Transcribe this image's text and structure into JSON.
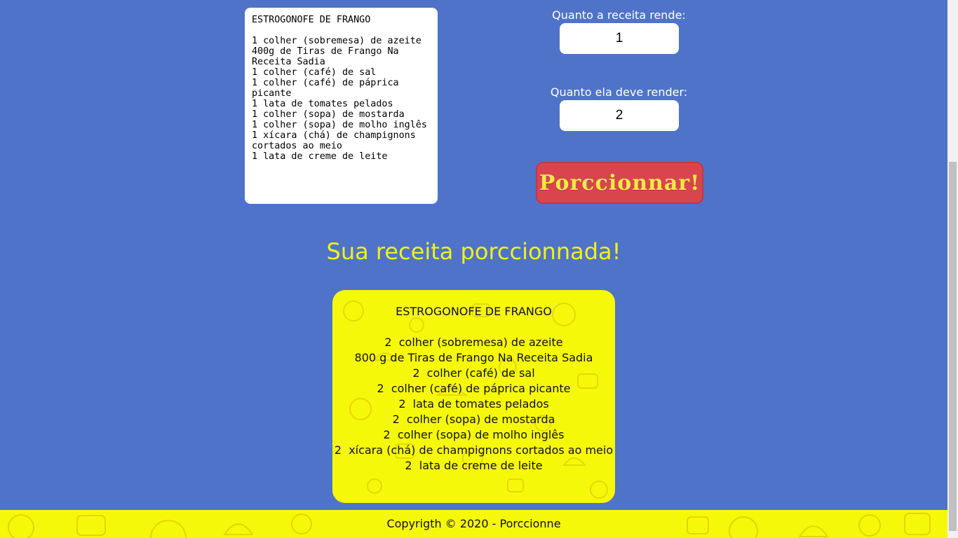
{
  "input": {
    "recipe_text": "ESTROGONOFE DE FRANGO\n\n1 colher (sobremesa) de azeite\n400g de Tiras de Frango Na Receita Sadia\n1 colher (café) de sal\n1 colher (café) de páprica picante\n1 lata de tomates pelados\n1 colher (sopa) de mostarda\n1 colher (sopa) de molho inglês\n1 xícara (chá) de champignons cortados ao meio\n1 lata de creme de leite"
  },
  "controls": {
    "yield_label": "Quanto a receita rende:",
    "yield_value": "1",
    "target_label": "Quanto ela deve render:",
    "target_value": "2",
    "button_label": "Porccionnar!"
  },
  "result": {
    "title": "Sua receita porccionnada!",
    "lines": [
      "ESTROGONOFE DE FRANGO",
      "",
      "2  colher (sobremesa) de azeite",
      "800 g de Tiras de Frango Na Receita Sadia",
      "2  colher (café) de sal",
      "2  colher (café) de páprica picante",
      "2  lata de tomates pelados",
      "2  colher (sopa) de mostarda",
      "2  colher (sopa) de molho inglês",
      "2  xícara (chá) de champignons cortados ao meio",
      "2  lata de creme de leite"
    ]
  },
  "footer": {
    "copyright": "Copyrigth © 2020 - Porccionne"
  },
  "colors": {
    "background": "#4f73c8",
    "accent_yellow": "#f6f80a",
    "title_yellow": "#f0f21a",
    "button_red": "#d9454f"
  }
}
